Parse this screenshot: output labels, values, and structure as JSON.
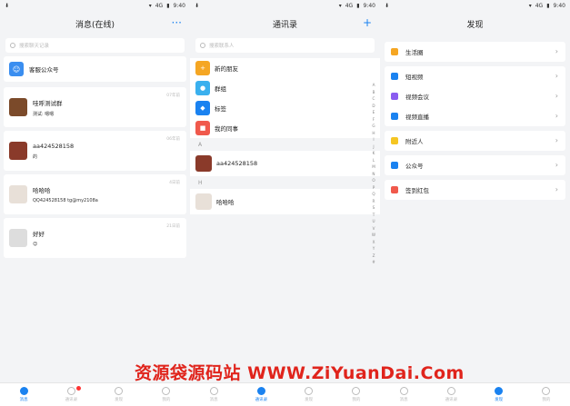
{
  "status": {
    "time": "9:40",
    "sim": "4G"
  },
  "panels": {
    "messages": {
      "title": "消息(在线)",
      "more_icon": "···",
      "search_placeholder": "搜索聊天记录",
      "service": {
        "label": "客服公众号"
      },
      "chats": [
        {
          "name": "哇呼测试群",
          "preview": "测试: 嗯嗯",
          "time": "07年前"
        },
        {
          "name": "aa424528158",
          "preview": "的",
          "time": "06年前"
        },
        {
          "name": "哈哈哈",
          "preview": "QQ424528158 tg@my2108a",
          "time": "4日前"
        },
        {
          "name": "好好",
          "preview": "😊",
          "time": "21日前"
        }
      ]
    },
    "contacts": {
      "title": "通讯录",
      "add_icon": "+",
      "search_placeholder": "搜索联系人",
      "items": [
        {
          "label": "新的朋友",
          "color": "#f5a623"
        },
        {
          "label": "群组",
          "color": "#3ab0ee"
        },
        {
          "label": "标签",
          "color": "#1a82f0"
        },
        {
          "label": "我的同事",
          "color": "#f0594c"
        }
      ],
      "section_a": "A",
      "contact_a": "aa424528158",
      "section_h": "H",
      "contact_h": "哈哈哈",
      "index": [
        "A",
        "B",
        "C",
        "D",
        "E",
        "F",
        "G",
        "H",
        "I",
        "J",
        "K",
        "L",
        "M",
        "N",
        "O",
        "P",
        "Q",
        "R",
        "S",
        "T",
        "U",
        "V",
        "W",
        "X",
        "Y",
        "Z",
        "#"
      ]
    },
    "discover": {
      "title": "发现",
      "groups": [
        [
          {
            "label": "生活圈",
            "color": "#f5a623"
          }
        ],
        [
          {
            "label": "短视频",
            "color": "#1a82f0"
          },
          {
            "label": "视频会议",
            "color": "#8a5cf0"
          },
          {
            "label": "视频直播",
            "color": "#1a82f0"
          }
        ],
        [
          {
            "label": "附近人",
            "color": "#f5c623"
          }
        ],
        [
          {
            "label": "公众号",
            "color": "#1a82f0"
          }
        ],
        [
          {
            "label": "签到红包",
            "color": "#f0594c"
          }
        ]
      ],
      "chevron": "›"
    }
  },
  "tabs": [
    "消息",
    "通讯录",
    "发现",
    "我的"
  ],
  "watermark": "资源袋源码站  WWW.ZiYuanDai.Com"
}
